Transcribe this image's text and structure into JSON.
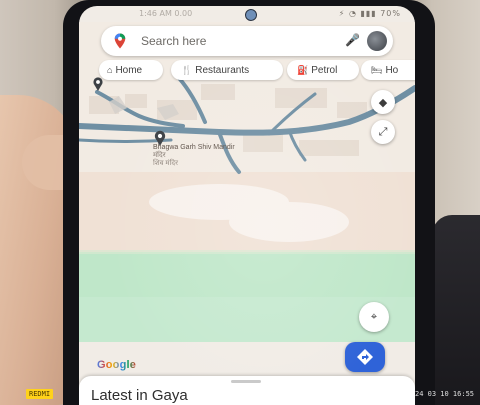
{
  "photo": {
    "colors": {
      "map_roads": "#6f8fa3",
      "map_land": "#efe4d8",
      "map_green": "#bfe7c9",
      "directions_fab": "#2f63d8"
    }
  },
  "status_bar": {
    "time": "1:46 AM 0.00",
    "icons_text": "⚡ ◔ ▮▮▮ 70%"
  },
  "search": {
    "placeholder": "Search here",
    "icon_left": "maps-pin-icon",
    "icon_mic": "microphone-icon",
    "icon_avatar": "avatar-icon"
  },
  "chips": [
    {
      "label": "Home",
      "icon": "home-icon"
    },
    {
      "label": "Restaurants",
      "icon": "restaurant-icon"
    },
    {
      "label": "Petrol",
      "icon": "fuel-icon"
    },
    {
      "label": "Ho",
      "icon": "hotel-icon"
    }
  ],
  "map": {
    "place_label_1": "Bhagwa Garh Shiv Mandir",
    "place_label_2": "मंदिर",
    "place_label_3": "शिव मंदिर"
  },
  "google_logo_text": "Google",
  "bottom_sheet": {
    "title": "Latest in Gaya"
  },
  "overlay": {
    "left_stamp": "REDMI",
    "right_stamp": "2024 03 10 16:55"
  }
}
